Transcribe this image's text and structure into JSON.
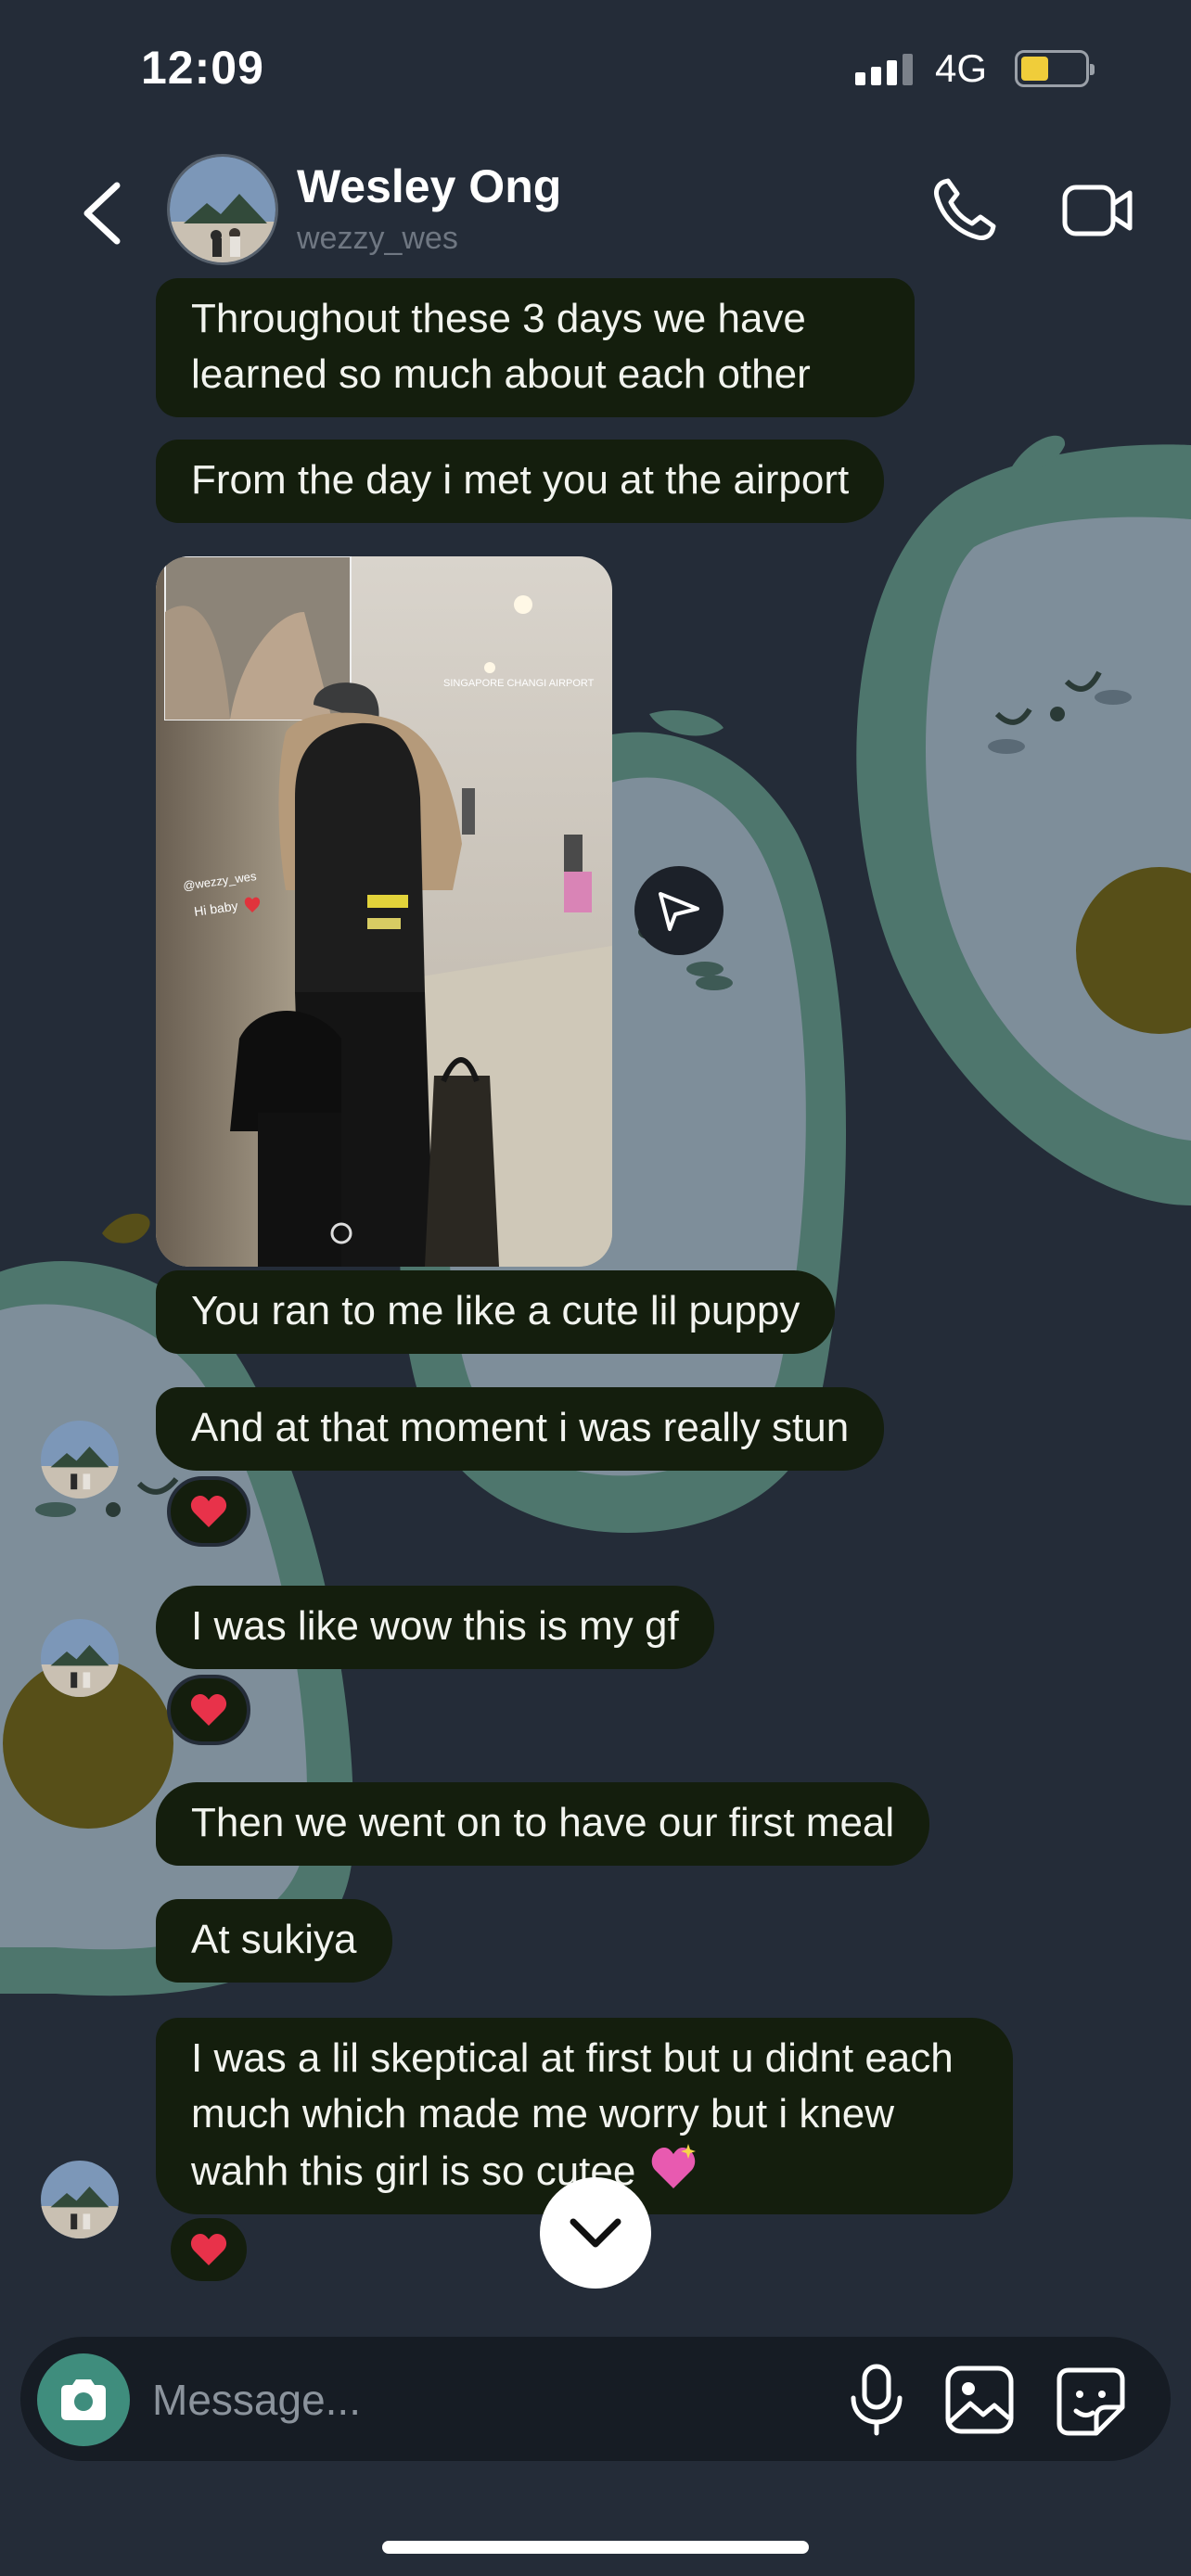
{
  "status_bar": {
    "time": "12:09",
    "network": "4G"
  },
  "header": {
    "name": "Wesley Ong",
    "username": "wezzy_wes"
  },
  "messages": [
    {
      "text": "Throughout these 3 days we have learned so much about each other"
    },
    {
      "text": "From the day i met you at the airport"
    },
    {
      "text": "You ran to me like a cute lil puppy"
    },
    {
      "text": "And at that moment i was really stun"
    },
    {
      "text": "I was like wow this is my gf"
    },
    {
      "text": "Then we went on to have our first meal"
    },
    {
      "text": "At sukiya"
    },
    {
      "text": "I was a lil skeptical at first but u didnt each much which made me worry but i knew wahh this girl is so cutee"
    }
  ],
  "photo": {
    "location_tag": "SINGAPORE CHANGI AIRPORT",
    "mention": "@wezzy_wes",
    "caption": "Hi baby"
  },
  "reactions": {
    "emoji": "heart"
  },
  "composer": {
    "placeholder": "Message..."
  },
  "colors": {
    "background": "#242c38",
    "bubble": "#141e0d",
    "accent": "#3f8d7d",
    "battery": "#f0cd3a"
  }
}
